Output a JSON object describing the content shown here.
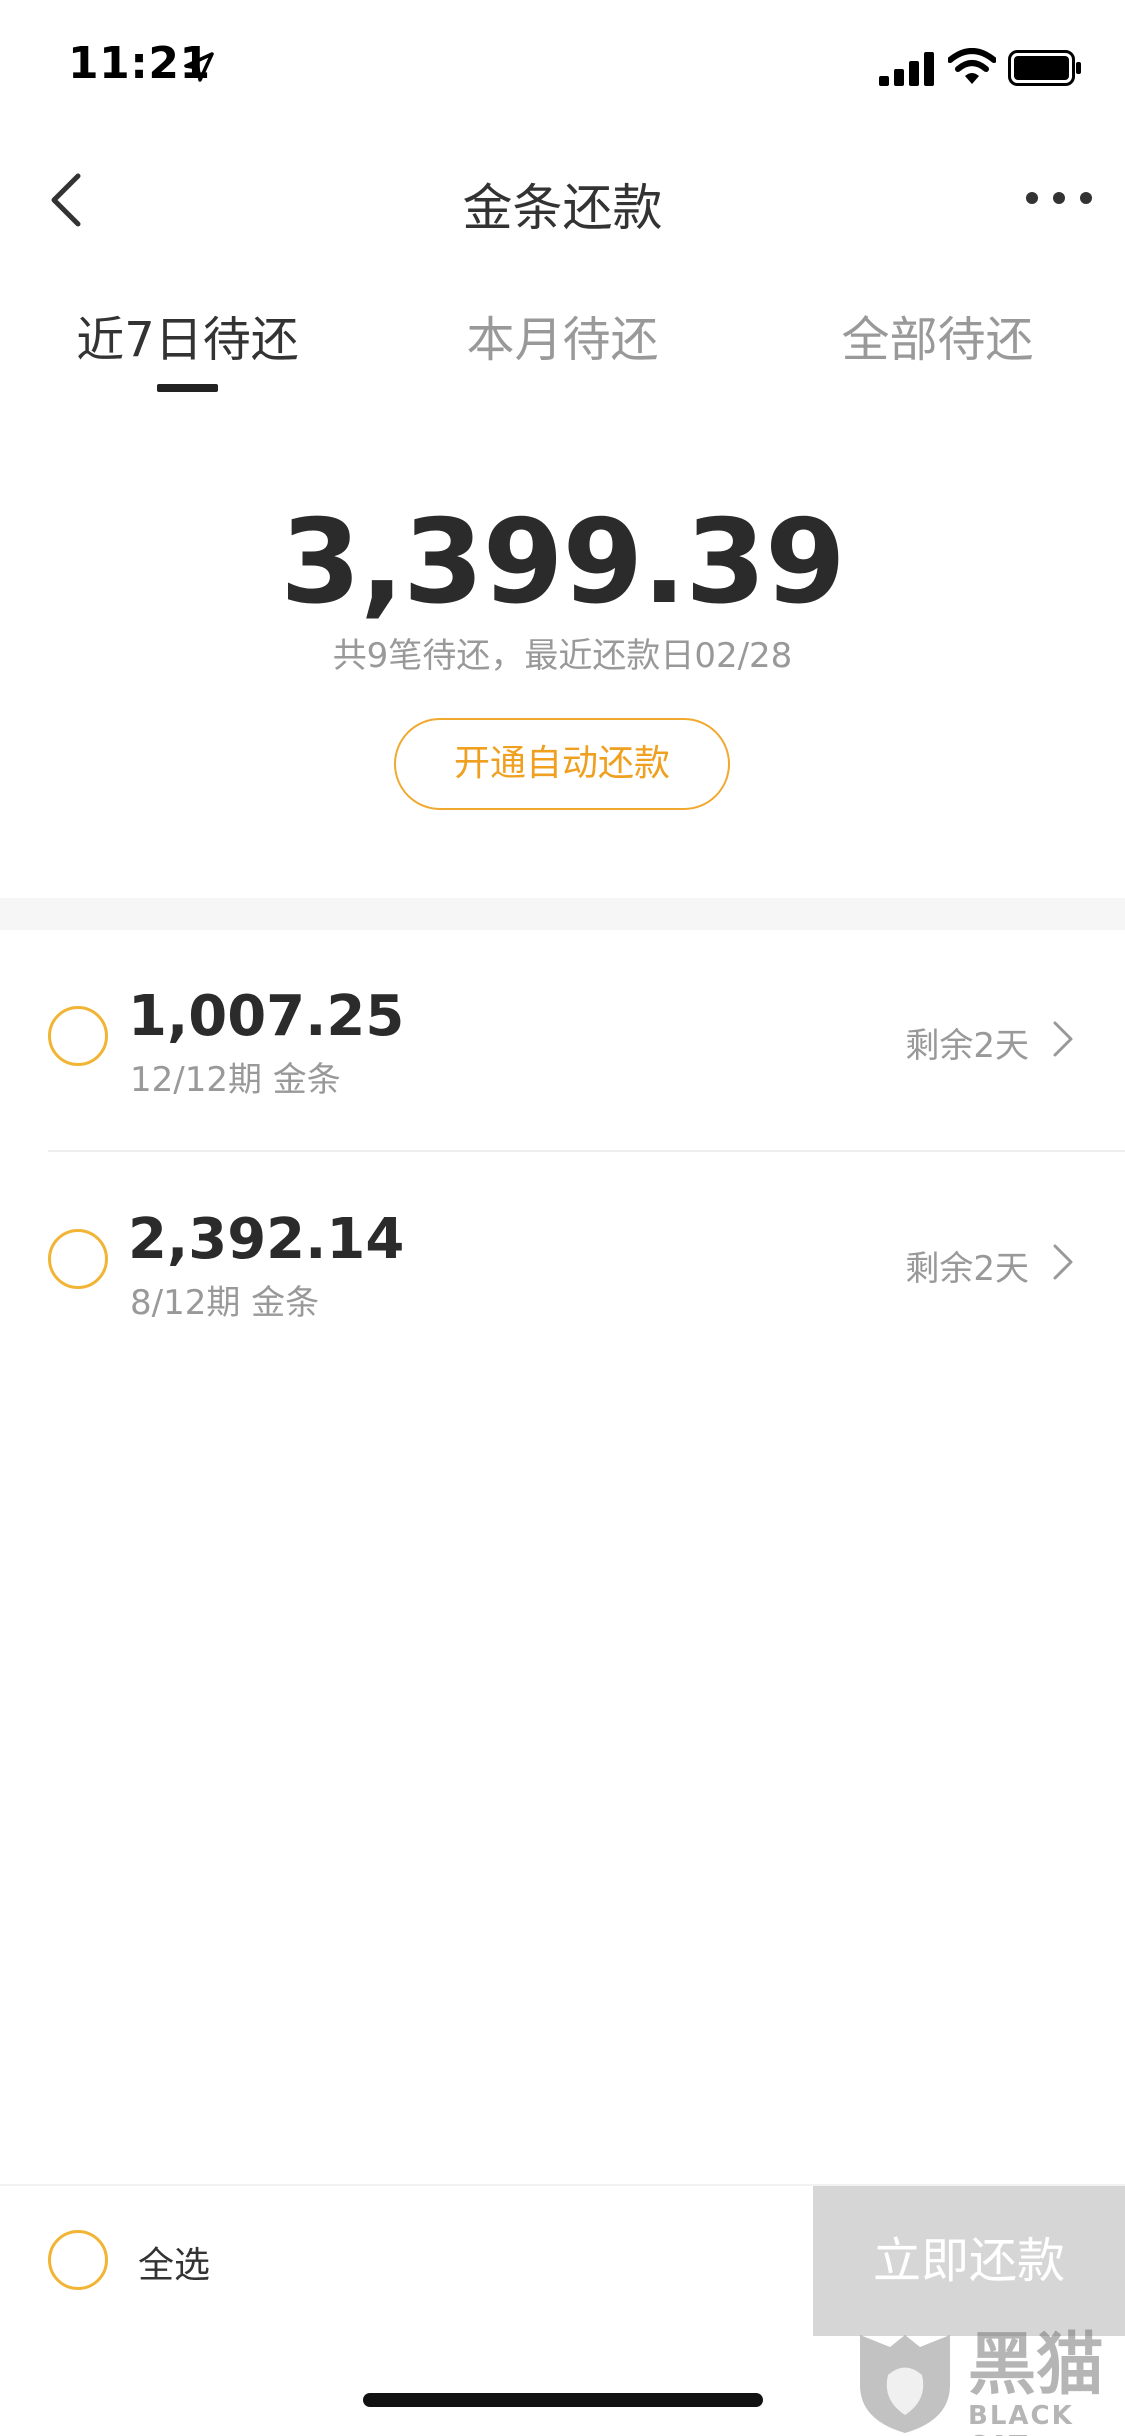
{
  "status_bar": {
    "time": "11:21",
    "icons": [
      "location-arrow-icon",
      "cellular-signal-icon",
      "wifi-icon",
      "battery-icon"
    ]
  },
  "nav": {
    "title": "金条还款",
    "back_icon": "chevron-left-icon",
    "more_icon": "more-dots-icon"
  },
  "tabs": [
    {
      "label": "近7日待还",
      "active": true
    },
    {
      "label": "本月待还",
      "active": false
    },
    {
      "label": "全部待还",
      "active": false
    }
  ],
  "summary": {
    "amount": "3,399.39",
    "subtitle": "共9笔待还，最近还款日02/28",
    "auto_repay_label": "开通自动还款"
  },
  "items": [
    {
      "amount": "1,007.25",
      "subtitle": "12/12期  金条",
      "remaining": "剩余2天"
    },
    {
      "amount": "2,392.14",
      "subtitle": "8/12期  金条",
      "remaining": "剩余2天"
    }
  ],
  "bottom": {
    "select_all_label": "全选",
    "pay_button_label": "立即还款"
  },
  "watermark": {
    "text": "黑猫",
    "subtext": "BLACK CAT"
  },
  "colors": {
    "accent": "#f1b434",
    "button_disabled": "#d6d6d6",
    "text_primary": "#333333",
    "text_secondary": "#999999"
  }
}
